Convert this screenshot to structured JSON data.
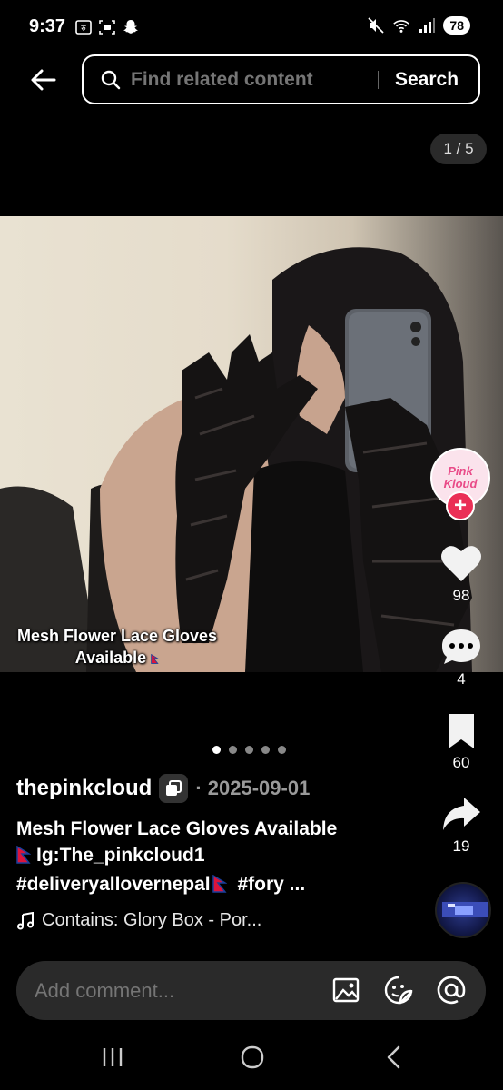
{
  "status_bar": {
    "time": "9:37",
    "battery": "78",
    "left_icons": [
      "currency-icon",
      "screen-capture-icon",
      "snapchat-icon"
    ],
    "right_icons": [
      "mute-icon",
      "wifi-icon",
      "signal-icon"
    ]
  },
  "header": {
    "search_placeholder": "Find related content",
    "search_button": "Search"
  },
  "gallery": {
    "counter": "1 / 5",
    "caption_line1": "Mesh Flower Lace Gloves",
    "caption_line2": "Available",
    "dots_total": 5,
    "dots_active": 0
  },
  "rail": {
    "avatar_text": "Pink Kloud",
    "likes": "98",
    "comments": "4",
    "saves": "60",
    "shares": "19"
  },
  "post": {
    "author": "thepinkcloud",
    "date": "· 2025-09-01",
    "title_line1": "Mesh Flower Lace Gloves Available",
    "title_line2": "Ig:The_pinkcloud1",
    "hashtags": "#deliveryallovernepal",
    "hashtags_more": "#fory ...",
    "music": "Contains: Glory Box - Por..."
  },
  "comment_bar": {
    "placeholder": "Add comment..."
  },
  "colors": {
    "background": "#000000",
    "accent_red": "#ea2f56",
    "pill_bg": "#2a2a2a",
    "muted_text": "#9a9a9a"
  }
}
